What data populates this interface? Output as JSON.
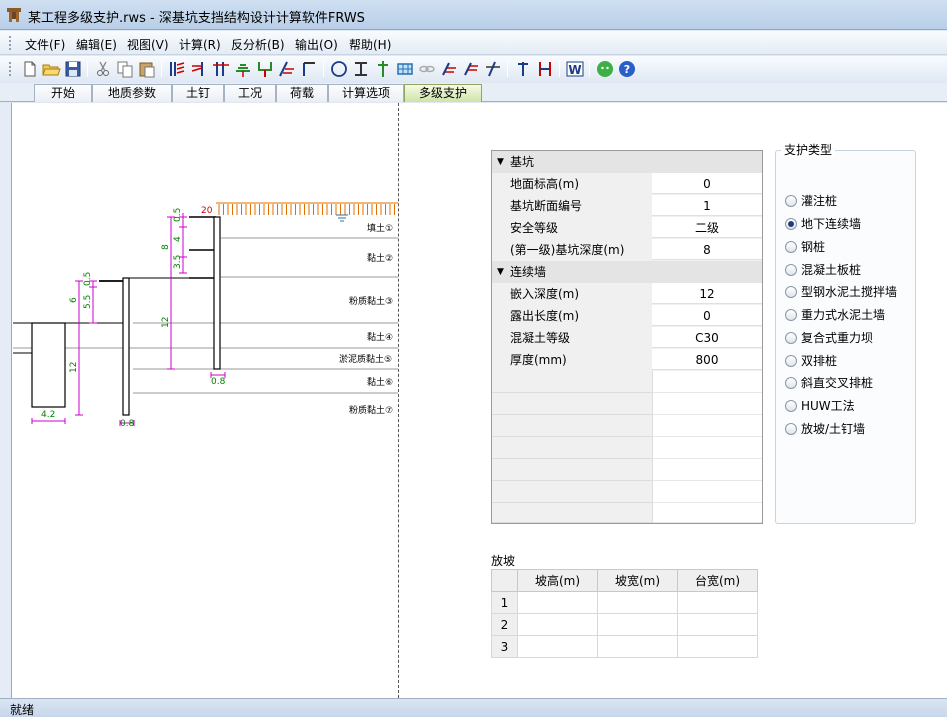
{
  "window": {
    "title": "某工程多级支护.rws - 深基坑支挡结构设计计算软件FRWS"
  },
  "menu": [
    "文件(F)",
    "编辑(E)",
    "视图(V)",
    "计算(R)",
    "反分析(B)",
    "输出(O)",
    "帮助(H)"
  ],
  "toolbar": {
    "buttons": [
      "new-file-icon",
      "open-folder-icon",
      "save-icon",
      "cut-icon",
      "copy-icon",
      "paste-icon",
      "pile-wall-icon",
      "anchor-icon",
      "strut-icon",
      "soil-nail-icon",
      "drain-icon",
      "slope-icon",
      "retaining-icon",
      "circle-slip-icon",
      "beam-icon",
      "column-icon",
      "grid-icon",
      "chain-icon",
      "layer-a-icon",
      "layer-b-icon",
      "layer-c-icon",
      "section-icon",
      "support-red-icon",
      "word-export-icon",
      "chat-icon",
      "help-icon"
    ]
  },
  "tabs": [
    "开始",
    "地质参数",
    "土钉",
    "工况",
    "荷载",
    "计算选项",
    "多级支护"
  ],
  "active_tab": "多级支护",
  "drawing": {
    "load_value": "20",
    "soil_layers": [
      "填土①",
      "黏土②",
      "粉质黏土③",
      "黏土④",
      "淤泥质黏土⑤",
      "黏土⑥",
      "粉质黏土⑦"
    ],
    "dims": {
      "tier3_top": "0.5",
      "tier3_a": "4",
      "tier3_b": "3.5",
      "tier3_total": "8",
      "tier3_embed": "12",
      "tier3_width": "0.8",
      "tier2_top": "0.5",
      "tier2_a": "5.5",
      "tier2_total": "6",
      "tier2_width": "0.8",
      "tier1_embed": "12",
      "tier1_width": "4.2"
    }
  },
  "properties": {
    "categories": [
      {
        "name": "基坑",
        "rows": [
          {
            "key": "地面标高(m)",
            "value": "0"
          },
          {
            "key": "基坑断面编号",
            "value": "1"
          },
          {
            "key": "安全等级",
            "value": "二级"
          },
          {
            "key": "(第一级)基坑深度(m)",
            "value": "8"
          }
        ]
      },
      {
        "name": "连续墙",
        "rows": [
          {
            "key": "嵌入深度(m)",
            "value": "12"
          },
          {
            "key": "露出长度(m)",
            "value": "0"
          },
          {
            "key": "混凝土等级",
            "value": "C30"
          },
          {
            "key": "厚度(mm)",
            "value": "800"
          }
        ]
      }
    ]
  },
  "support_type": {
    "title": "支护类型",
    "options": [
      "灌注桩",
      "地下连续墙",
      "钢桩",
      "混凝土板桩",
      "型钢水泥土搅拌墙",
      "重力式水泥土墙",
      "复合式重力坝",
      "双排桩",
      "斜直交叉排桩",
      "HUW工法",
      "放坡/土钉墙"
    ],
    "selected": "地下连续墙"
  },
  "slope": {
    "title": "放坡",
    "columns": [
      "坡高(m)",
      "坡宽(m)",
      "台宽(m)"
    ],
    "row_numbers": [
      "1",
      "2",
      "3"
    ]
  },
  "status": {
    "text": "就绪"
  },
  "colors": {
    "dimension": "#cc00cc",
    "dimension_text": "#008000",
    "load_arrows": "#e07000",
    "load_text": "#cc0000",
    "layer_lines": "#999999"
  }
}
